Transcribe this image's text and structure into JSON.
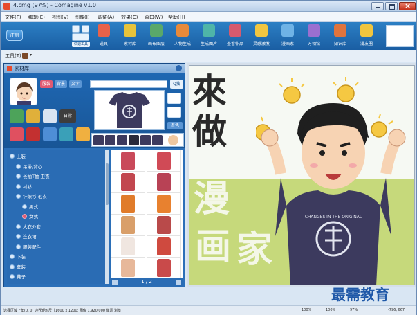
{
  "window": {
    "title": "4.cmg (97%) - Comagine v1.0"
  },
  "menu": [
    "文件(F)",
    "编辑(E)",
    "视图(V)",
    "图像(I)",
    "调整(A)",
    "效果(C)",
    "窗口(W)",
    "帮助(H)"
  ],
  "toolbar": {
    "login": "注册",
    "mini_label": "快速工具",
    "buttons": [
      {
        "label": "道具",
        "icon": "pencil-tool-icon",
        "color": "#e8624a"
      },
      {
        "label": "素材库",
        "icon": "library-icon",
        "color": "#e7c33a"
      },
      {
        "label": "画布图层",
        "icon": "layers-icon",
        "color": "#5aa86a"
      },
      {
        "label": "人物生成",
        "icon": "character-icon",
        "color": "#e88a3a"
      },
      {
        "label": "生成图片",
        "icon": "generate-image-icon",
        "color": "#4fb5a8"
      },
      {
        "label": "查看作品",
        "icon": "view-works-icon",
        "color": "#d65a6e"
      },
      {
        "label": "灵感激发",
        "icon": "inspiration-icon",
        "color": "#f2c640"
      },
      {
        "label": "漫画家",
        "icon": "comic-artist-icon",
        "color": "#6fb3e6"
      },
      {
        "label": "万相馆",
        "icon": "gallery-icon",
        "color": "#9b6fd0"
      },
      {
        "label": "知识库",
        "icon": "knowledge-icon",
        "color": "#e0743d"
      },
      {
        "label": "漫友圈",
        "icon": "community-icon",
        "color": "#f0c53f"
      }
    ]
  },
  "subbar": {
    "tool_label": "工具(T)"
  },
  "library": {
    "title": "素材库",
    "tags": [
      "服装",
      "背景",
      "文字"
    ],
    "search_button": "Q搜",
    "side_button": "着色",
    "category_label": "日常",
    "tree": [
      {
        "label": "上装",
        "level": 0
      },
      {
        "label": "吊带/背心",
        "level": 1
      },
      {
        "label": "长袖T恤 卫衣",
        "level": 1
      },
      {
        "label": "衬衫",
        "level": 1
      },
      {
        "label": "针织衫 毛衣",
        "level": 1
      },
      {
        "label": "男式",
        "level": 2
      },
      {
        "label": "女式",
        "level": 2,
        "selected": true
      },
      {
        "label": "大衣外套",
        "level": 1
      },
      {
        "label": "连衣裙",
        "level": 1
      },
      {
        "label": "服装配件",
        "level": 1
      },
      {
        "label": "下装",
        "level": 0
      },
      {
        "label": "套装",
        "level": 0
      },
      {
        "label": "鞋子",
        "level": 0
      }
    ],
    "grid_colors": [
      "#c9495a",
      "#d04a56",
      "#c2474f",
      "#b84255",
      "#e07b2a",
      "#e8812f",
      "#d99f6a",
      "#b94a4a",
      "#f0e6e0",
      "#cf4a3f",
      "#e7b89a",
      "#c94a4a"
    ],
    "pager": "1 / 2"
  },
  "canvas": {
    "heading_chars": [
      "來",
      "做"
    ],
    "title_chars": [
      "漫",
      "画",
      "家"
    ],
    "shirt_text": "CHANGES IN THE ORIGINAL"
  },
  "status": {
    "text": "选择区域上角(0, 0) 边界矩形尺寸1600 x 1200; 图像 1,920,000 像素 浏览",
    "zoom1": "100%",
    "zoom2": "100%",
    "zoom3": "97%",
    "coords": "-796, 667"
  },
  "watermark": "最需教育"
}
